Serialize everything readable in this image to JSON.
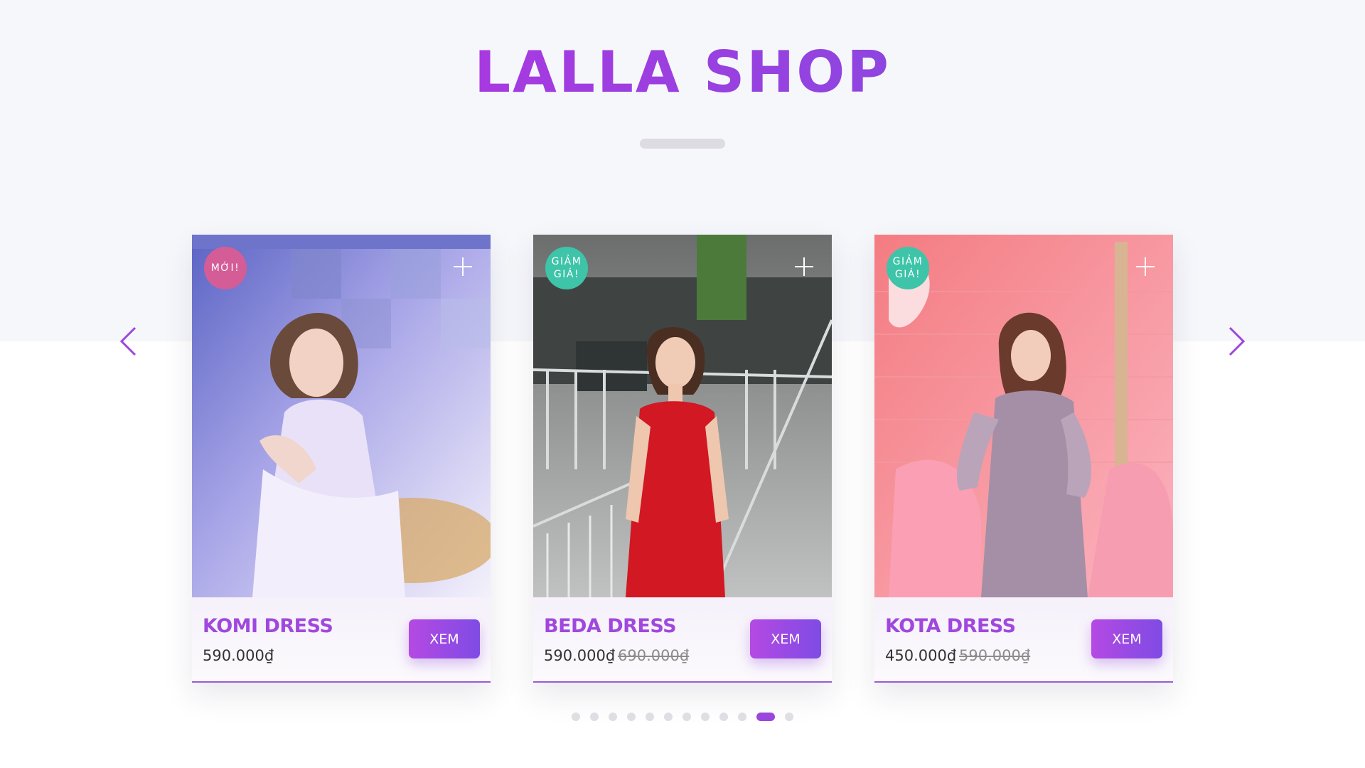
{
  "header": {
    "title": "LALLA SHOP"
  },
  "navigation": {
    "prev_icon": "chevron-left-icon",
    "next_icon": "chevron-right-icon"
  },
  "products": [
    {
      "name": "KOMI DRESS",
      "price": "590.000₫",
      "old_price": "",
      "badge": "MỚI!",
      "badge_type": "new",
      "button_label": "XEM",
      "image": "woman-in-white-lace-dress-photo"
    },
    {
      "name": "BEDA DRESS",
      "price": "590.000₫",
      "old_price": "690.000₫",
      "badge": "GIẢM\nGIÁ!",
      "badge_type": "sale",
      "button_label": "XEM",
      "image": "woman-in-red-dress-photo"
    },
    {
      "name": "KOTA DRESS",
      "price": "450.000₫",
      "old_price": "590.000₫",
      "badge": "GIẢM\nGIÁ!",
      "badge_type": "sale",
      "button_label": "XEM",
      "image": "woman-in-lilac-dress-photo"
    }
  ],
  "pagination": {
    "total": 12,
    "active_index": 10
  },
  "colors": {
    "accent": "#a048dd",
    "badge_new": "#d45c97",
    "badge_sale": "#3ec4a8"
  }
}
